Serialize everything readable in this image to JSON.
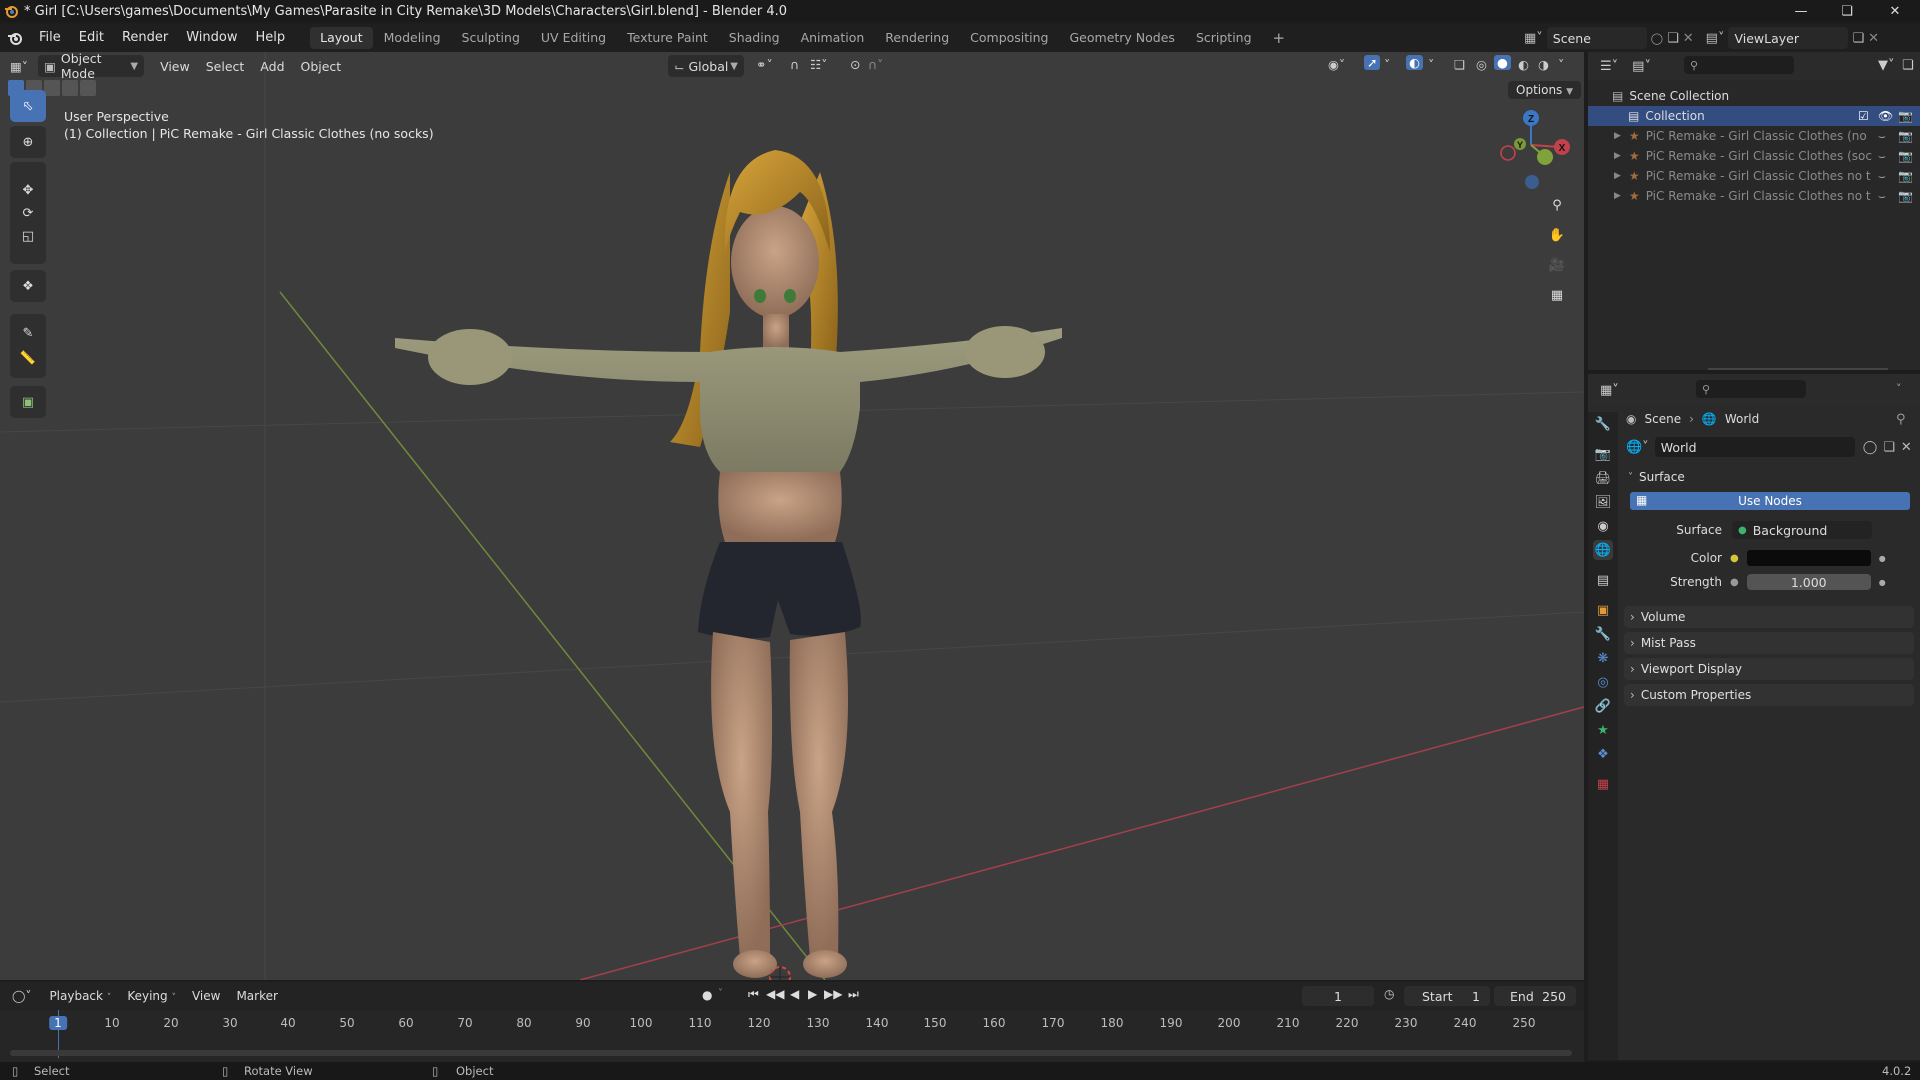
{
  "window": {
    "title": "* Girl [C:\\Users\\games\\Documents\\My Games\\Parasite in City Remake\\3D Models\\Characters\\Girl.blend] - Blender 4.0"
  },
  "menu": {
    "items": [
      "File",
      "Edit",
      "Render",
      "Window",
      "Help"
    ]
  },
  "workspaces": {
    "tabs": [
      "Layout",
      "Modeling",
      "Sculpting",
      "UV Editing",
      "Texture Paint",
      "Shading",
      "Animation",
      "Rendering",
      "Compositing",
      "Geometry Nodes",
      "Scripting"
    ],
    "active": "Layout"
  },
  "top_right": {
    "scene": "Scene",
    "view_layer": "ViewLayer"
  },
  "viewport": {
    "mode": "Object Mode",
    "menus": [
      "View",
      "Select",
      "Add",
      "Object"
    ],
    "orientation": "Global",
    "options_label": "Options",
    "overlay_title": "User Perspective",
    "overlay_subtitle": "(1) Collection | PiC Remake - Girl Classic Clothes (no socks)",
    "gizmo": {
      "z": "Z",
      "y": "Y",
      "x": "X"
    }
  },
  "outliner": {
    "scene_collection": "Scene Collection",
    "collection": "Collection",
    "objects": [
      "PiC Remake - Girl Classic Clothes (no",
      "PiC Remake - Girl Classic Clothes (soc",
      "PiC Remake - Girl Classic Clothes no t",
      "PiC Remake - Girl Classic Clothes no t"
    ]
  },
  "properties": {
    "breadcrumb": {
      "scene": "Scene",
      "world": "World"
    },
    "world_name": "World",
    "surface_panel": "Surface",
    "use_nodes": "Use Nodes",
    "surface_label": "Surface",
    "surface_value": "Background",
    "color_label": "Color",
    "color_value": "#0b0b0b",
    "strength_label": "Strength",
    "strength_value": "1.000",
    "panels": [
      "Volume",
      "Mist Pass",
      "Viewport Display",
      "Custom Properties"
    ]
  },
  "timeline": {
    "menus": [
      "Playback",
      "Keying",
      "View",
      "Marker"
    ],
    "current_frame": "1",
    "start_label": "Start",
    "start_value": "1",
    "end_label": "End",
    "end_value": "250",
    "ticks": [
      "1",
      "10",
      "20",
      "30",
      "40",
      "50",
      "60",
      "70",
      "80",
      "90",
      "100",
      "110",
      "120",
      "130",
      "140",
      "150",
      "160",
      "170",
      "180",
      "190",
      "200",
      "210",
      "220",
      "230",
      "240",
      "250"
    ]
  },
  "statusbar": {
    "select": "Select",
    "rotate": "Rotate View",
    "object": "Object",
    "version": "4.0.2"
  },
  "colors": {
    "accent": "#4772b3",
    "axis_x": "#c1424b",
    "axis_y": "#7fa33a",
    "axis_z": "#3a78c5"
  }
}
